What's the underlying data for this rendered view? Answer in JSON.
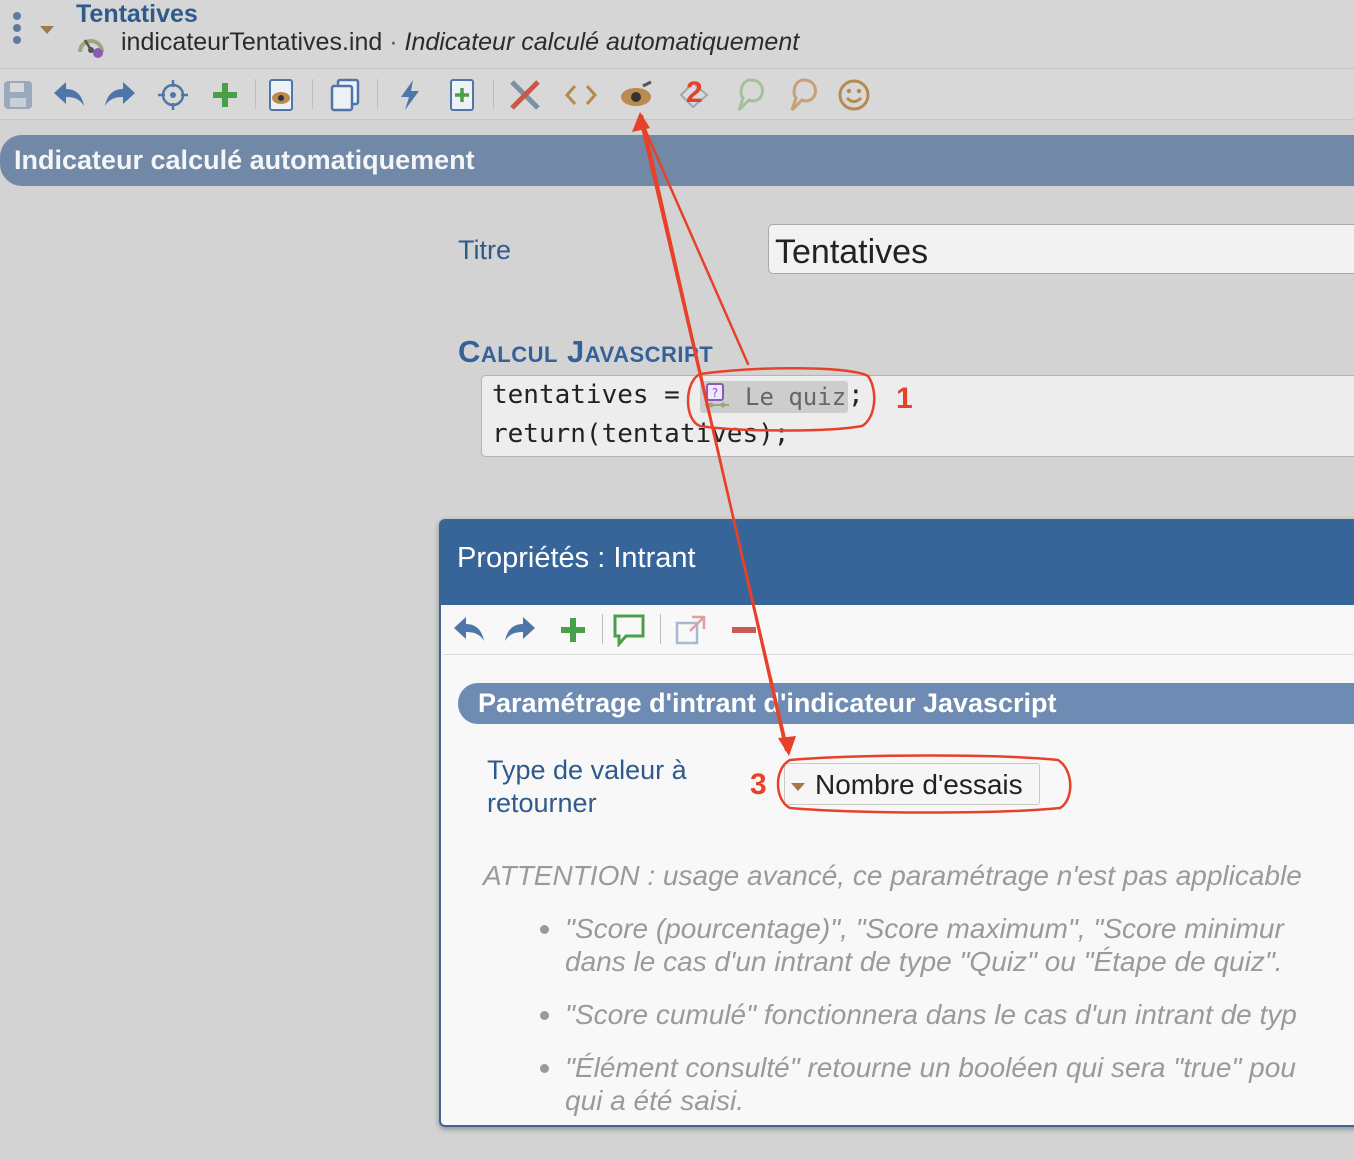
{
  "header": {
    "title": "Tentatives",
    "file_name": "indicateurTentatives.ind",
    "separator": " · ",
    "description": "Indicateur calculé automatiquement"
  },
  "toolbar": {
    "icons": [
      "save-icon",
      "undo-icon",
      "redo-icon",
      "target-icon",
      "add-icon",
      "preview-document-icon",
      "copy-icon",
      "lightning-icon",
      "new-document-icon",
      "tools-icon",
      "code-icon",
      "view-icon",
      "eraser-icon",
      "hint-bulb-icon",
      "hint-bulb-alt-icon",
      "smiley-icon"
    ]
  },
  "section": {
    "title": "Indicateur calculé automatiquement"
  },
  "form": {
    "titre_label": "Titre",
    "titre_value": "Tentatives",
    "calcul_heading": "Calcul Javascript",
    "code_line1_prefix": "tentatives = ",
    "code_chip_label": "Le quiz",
    "code_line1_suffix": ";",
    "code_line2": "return(tentatives);"
  },
  "dialog": {
    "title": "Propriétés : Intrant",
    "toolbar_icons": [
      "undo-icon",
      "redo-icon",
      "add-icon",
      "comment-icon",
      "open-external-icon",
      "remove-icon"
    ],
    "param_title": "Paramétrage d'intrant d'indicateur Javascript",
    "type_label_line1": "Type de valeur à",
    "type_label_line2": "retourner",
    "type_value": "Nombre d'essais",
    "warning": "ATTENTION : usage avancé, ce paramétrage n'est pas applicable",
    "bullets": [
      {
        "line1": "\"Score (pourcentage)\", \"Score maximum\", \"Score minimur",
        "line2": "dans le cas d'un intrant de type \"Quiz\" ou \"Étape de quiz\"."
      },
      {
        "line1": "\"Score cumulé\" fonctionnera dans le cas d'un intrant de typ",
        "line2": ""
      },
      {
        "line1": "\"Élément consulté\" retourne un booléen qui sera \"true\" pou",
        "line2": "qui a été saisi."
      }
    ]
  },
  "annotations": {
    "labels": [
      "1",
      "2",
      "3"
    ],
    "color": "#e8412a"
  },
  "colors": {
    "accent": "#2f5a8c",
    "section_bar": "#7188a6",
    "dialog_header": "#37659a",
    "annotation": "#e8412a"
  }
}
